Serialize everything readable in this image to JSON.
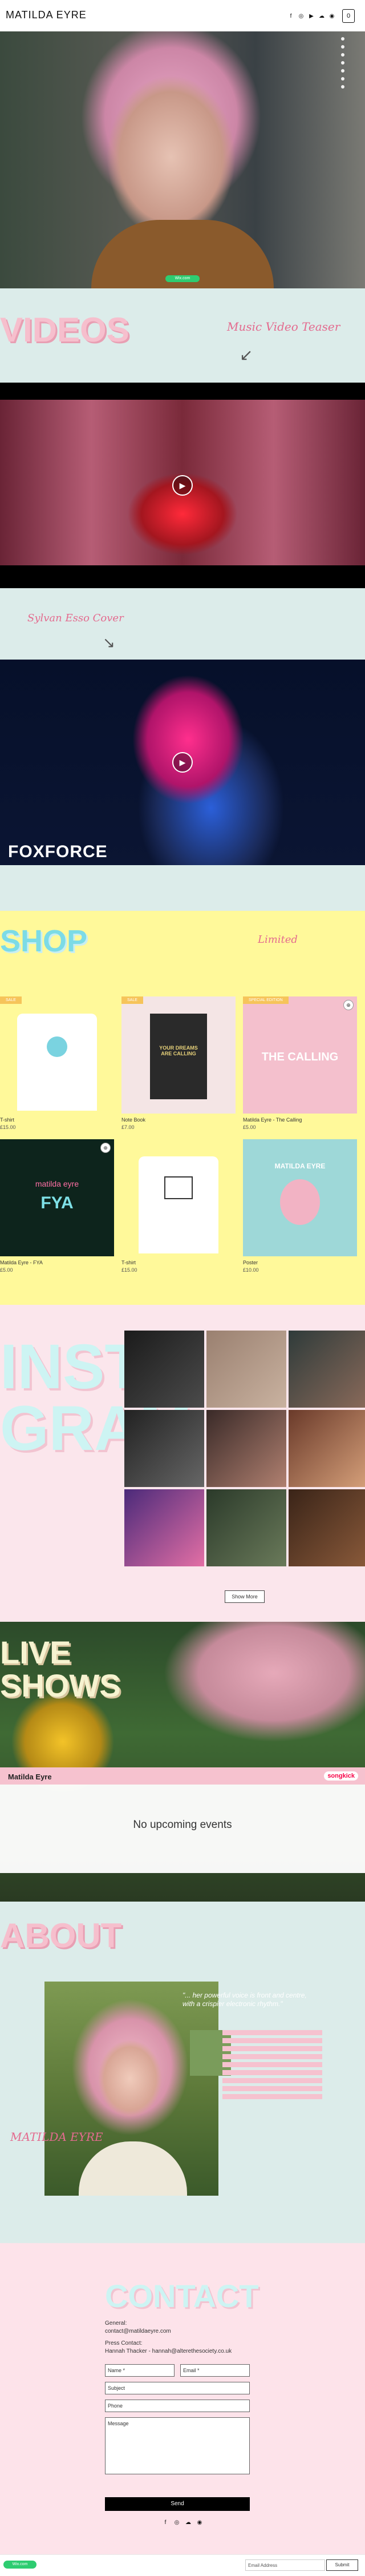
{
  "header": {
    "brand": "MATILDA EYRE",
    "social_icons": [
      "facebook-icon",
      "instagram-icon",
      "youtube-icon",
      "soundcloud-icon",
      "spotify-icon"
    ],
    "cart_count": "0"
  },
  "hero": {
    "wix_badge": "Wix.com"
  },
  "videos": {
    "title": "VIDEOS",
    "teaser_label": "Music Video Teaser",
    "cover_label": "Sylvan Esso Cover",
    "video2_caption": "FOXFORCE"
  },
  "shop": {
    "title": "SHOP",
    "script": "Limited",
    "products": [
      {
        "name": "T-shirt",
        "price": "£15.00",
        "ribbon": "SALE"
      },
      {
        "name": "Note Book",
        "price": "£7.00",
        "ribbon": "SALE"
      },
      {
        "name": "Matilda Eyre - The Calling",
        "price": "£5.00",
        "ribbon": "SPECIAL EDITION"
      },
      {
        "name": "Matilda Eyre - FYA",
        "price": "£5.00",
        "ribbon": ""
      },
      {
        "name": "T-shirt",
        "price": "£15.00",
        "ribbon": ""
      },
      {
        "name": "Poster",
        "price": "£10.00",
        "ribbon": ""
      }
    ],
    "art_text": {
      "notebook": "YOUR DREAMS ARE CALLING",
      "calling": "THE CALLING",
      "fya_brand": "matilda eyre",
      "fya": "FYA",
      "poster_brand": "MATILDA EYRE"
    }
  },
  "instagram": {
    "title_line1": "INSTA",
    "title_line2": "GRAM",
    "show_more": "Show More"
  },
  "live": {
    "title_line1": "LIVE",
    "title_line2": "SHOWS",
    "widget_artist": "Matilda Eyre",
    "widget_logo": "songkick",
    "empty_text": "No upcoming events"
  },
  "about": {
    "title": "ABOUT",
    "script": "MATILDA EYRE",
    "quote": "\"... her powerful voice is front and centre, with a crispier electronic rhythm.\""
  },
  "contact": {
    "title": "CONTACT",
    "general_label": "General:",
    "general_email": "contact@matildaeyre.com",
    "press_label": "Press Contact:",
    "press_contact": "Hannah Thacker - hannah@alterethesociety.co.uk",
    "name_placeholder": "Name *",
    "email_placeholder": "Email *",
    "subject_placeholder": "Subject",
    "phone_placeholder": "Phone",
    "message_placeholder": "Message",
    "send_label": "Send"
  },
  "footer": {
    "wix_badge": "Wix.com",
    "email_placeholder": "Email Address",
    "submit_label": "Submit"
  },
  "colors": {
    "pink_title": "#f6bfcd",
    "cyan_title": "#7cdbe6",
    "shop_bg": "#fff99a",
    "section_bg": "#dcecea"
  }
}
